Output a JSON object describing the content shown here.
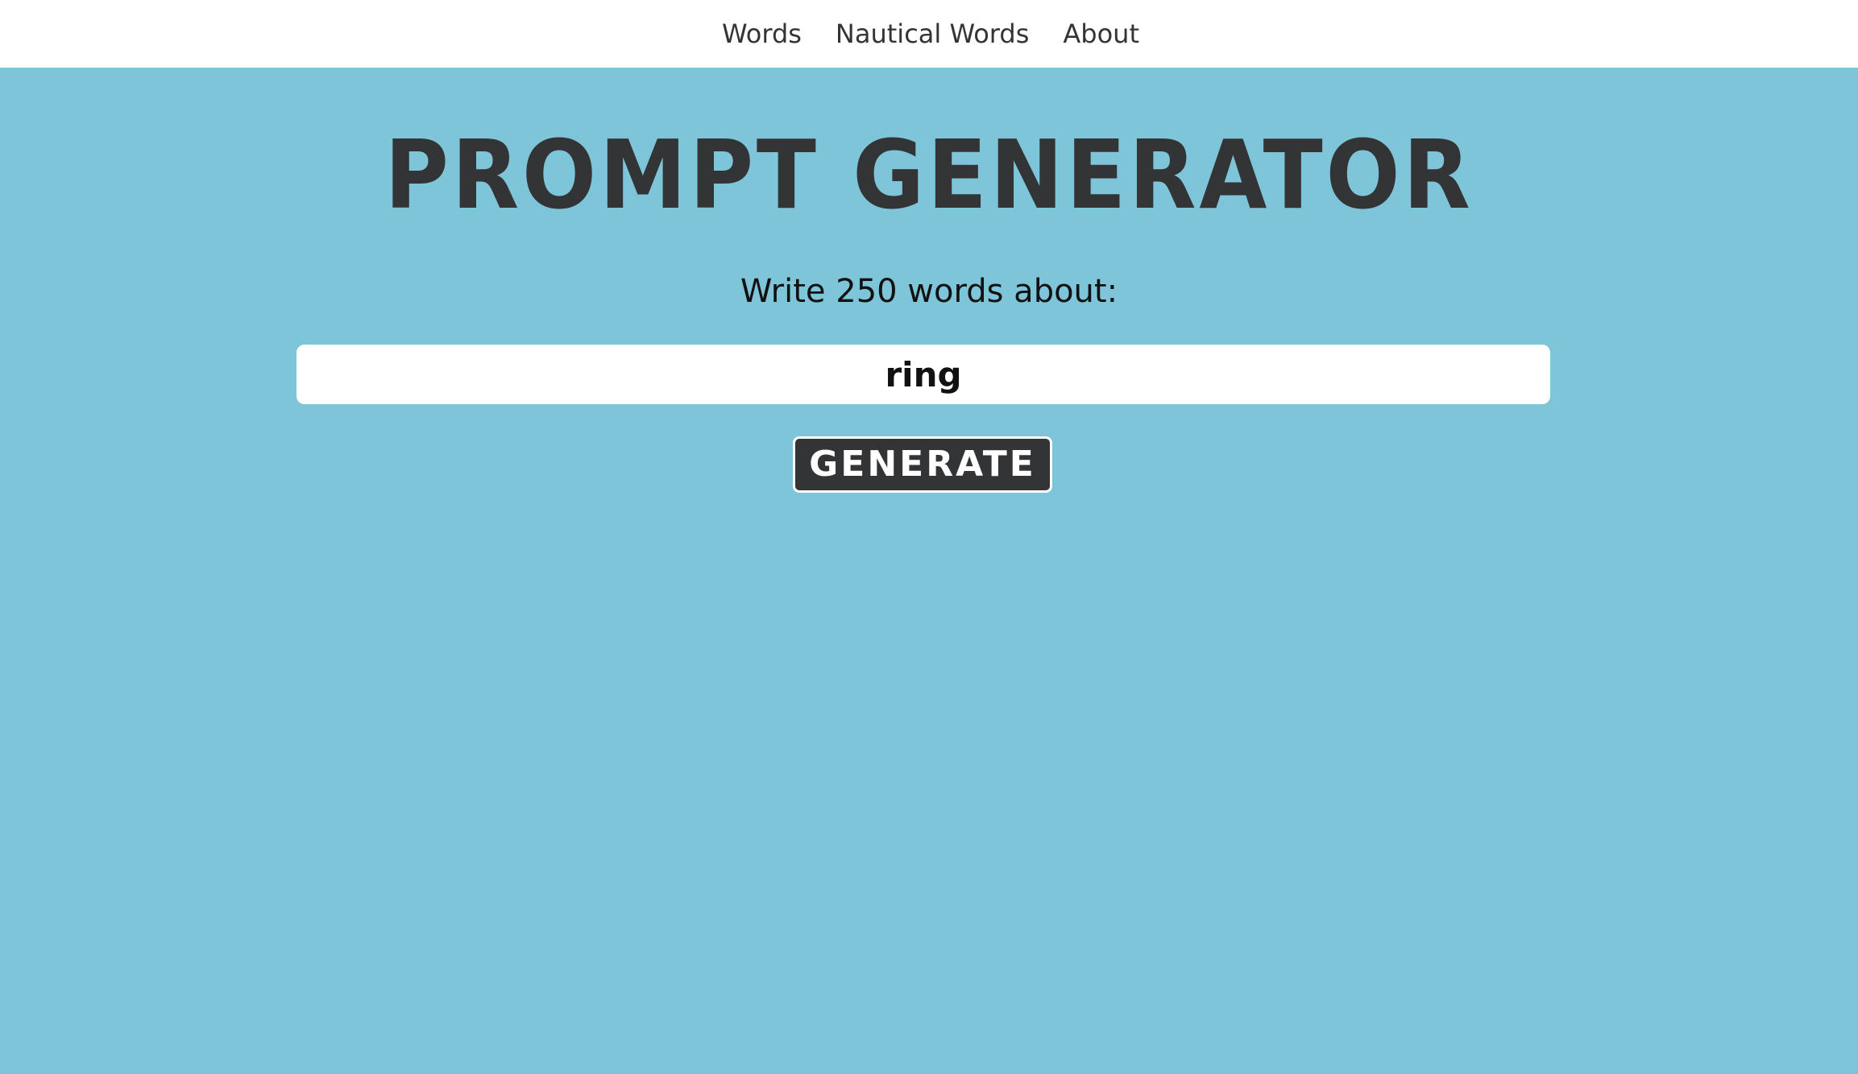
{
  "nav": {
    "items": [
      {
        "label": "Words"
      },
      {
        "label": "Nautical Words"
      },
      {
        "label": "About"
      }
    ]
  },
  "main": {
    "title": "PROMPT GENERATOR",
    "subtitle": "Write 250 words about:",
    "word_value": "ring",
    "generate_label": "GENERATE"
  },
  "colors": {
    "background": "#7ec5da",
    "navbar": "#ffffff",
    "title_text": "#333436",
    "button_bg": "#333436",
    "button_text": "#ffffff",
    "input_bg": "#ffffff"
  }
}
